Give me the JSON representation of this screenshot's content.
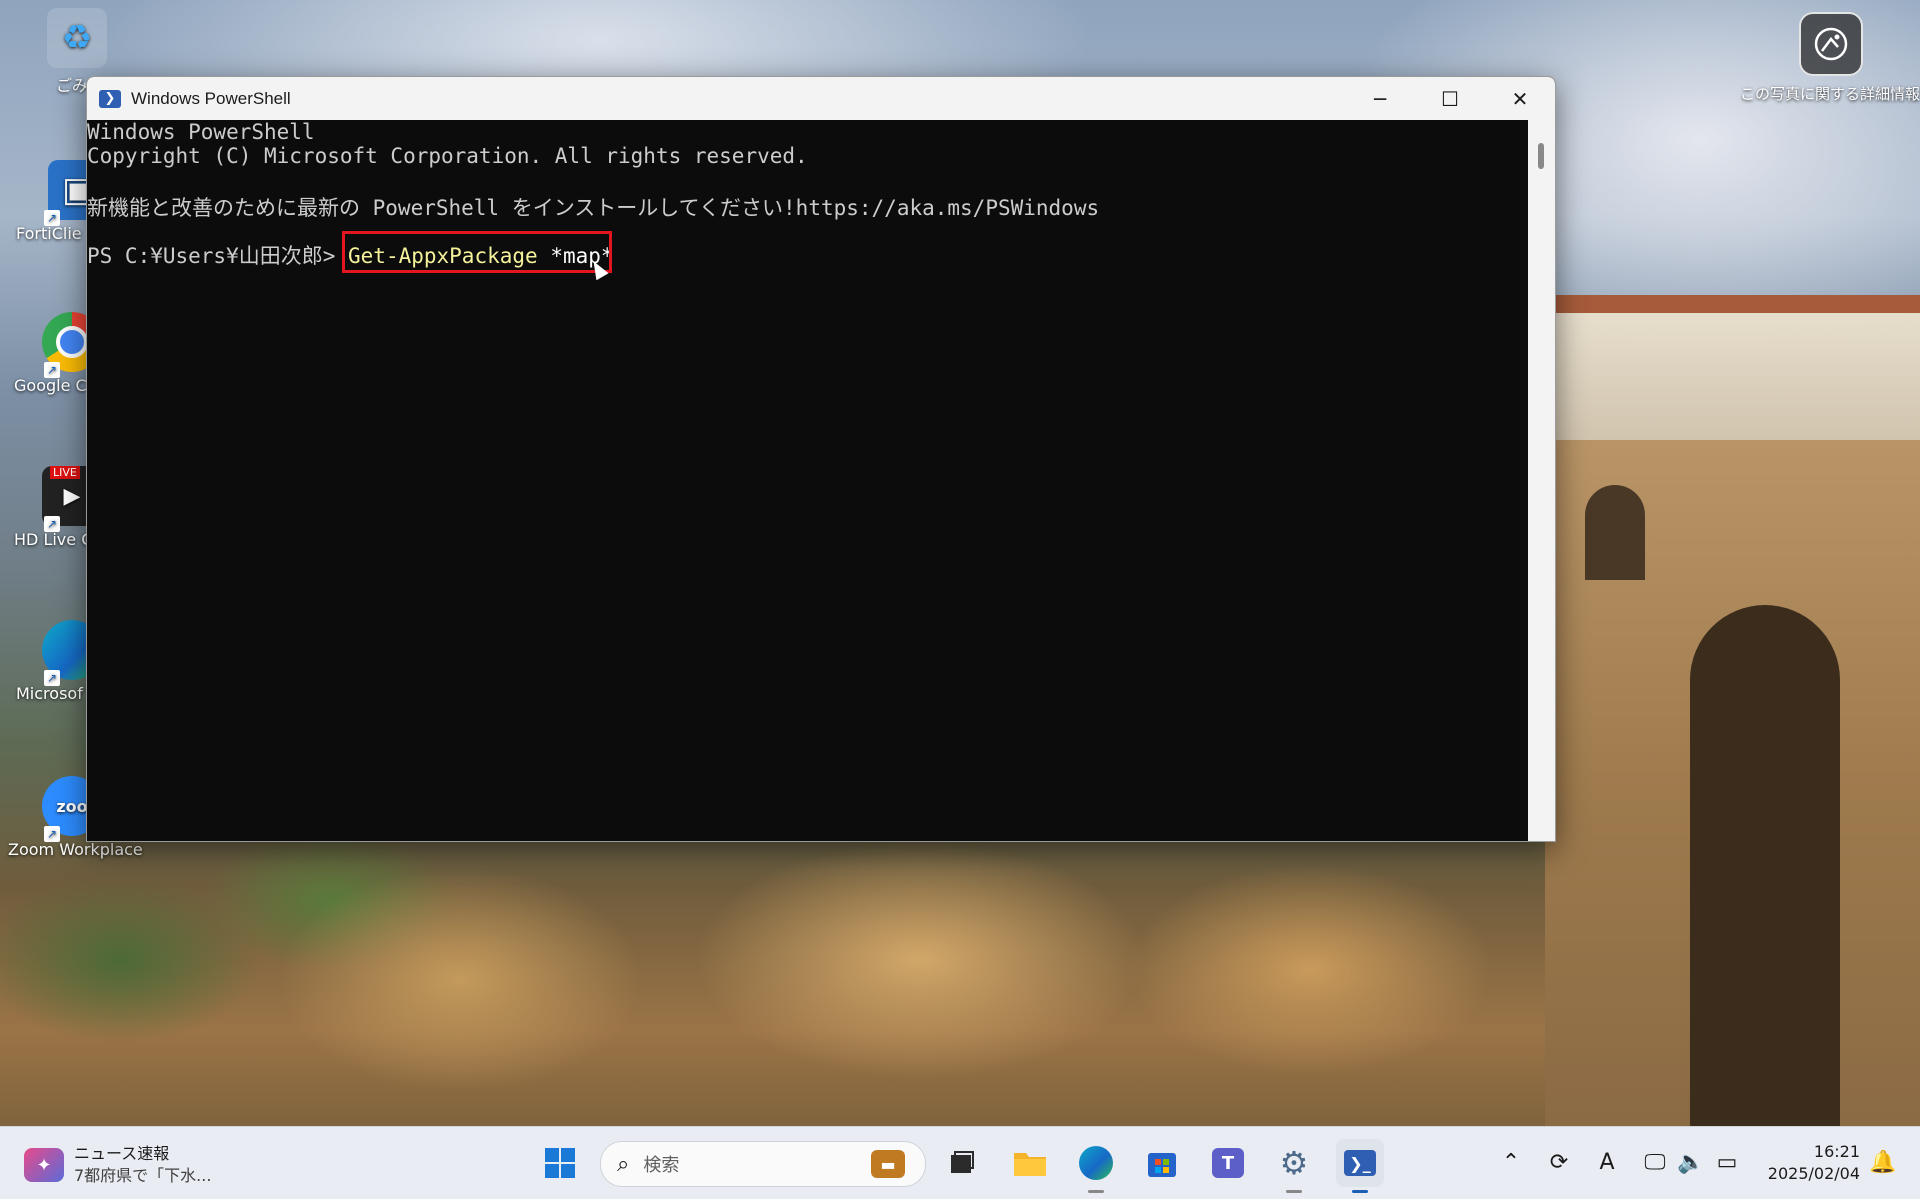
{
  "desktop": {
    "icons": [
      {
        "label": "ごみ",
        "name": "recycle-bin"
      },
      {
        "label": "FortiClie",
        "name": "forticlient"
      },
      {
        "label": "Google C",
        "name": "google-chrome"
      },
      {
        "label": "HD Live C",
        "name": "hd-live"
      },
      {
        "label": "Microsof",
        "name": "microsoft-edge"
      },
      {
        "label": "Zoom Workplace",
        "name": "zoom-workplace"
      }
    ],
    "live_badge": "LIVE",
    "photo_info": "この写真に関する詳細情報"
  },
  "window": {
    "title": "Windows PowerShell",
    "minimize": "─",
    "maximize": "☐",
    "close": "✕"
  },
  "console": {
    "line1": "Windows PowerShell",
    "line2": "Copyright (C) Microsoft Corporation. All rights reserved.",
    "line3": "新機能と改善のために最新の PowerShell をインストールしてください!https://aka.ms/PSWindows",
    "prompt": "PS C:¥Users¥山田次郎> ",
    "command": "Get-AppxPackage",
    "argument": " *map*"
  },
  "taskbar": {
    "news_title": "ニュース速報",
    "news_text": "7都府県で「下水...",
    "search_placeholder": "検索",
    "time": "16:21",
    "date": "2025/02/04",
    "ime": "A"
  },
  "colors": {
    "highlight": "#e3151e",
    "console_bg": "#0c0c0c",
    "command": "#f4f29a"
  }
}
